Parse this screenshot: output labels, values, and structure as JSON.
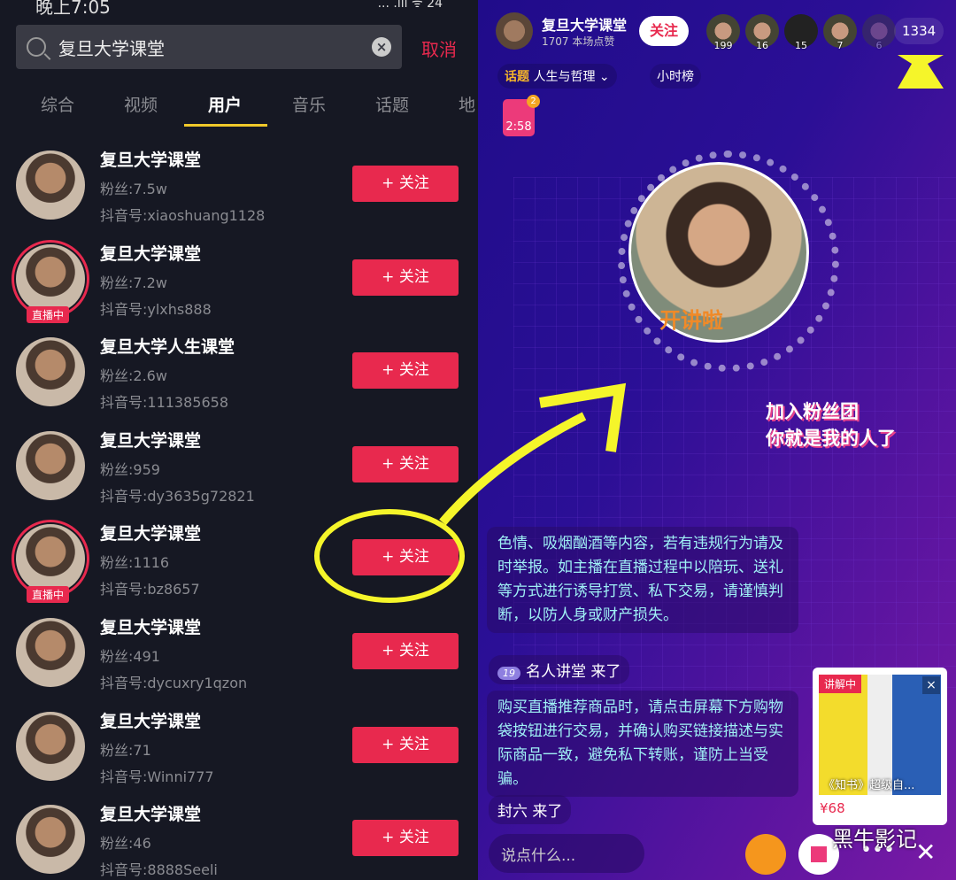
{
  "status": {
    "time": "晚上7:05",
    "icons": "... .ıll ᯤ 24"
  },
  "search": {
    "query": "复旦大学课堂",
    "cancel": "取消"
  },
  "tabs": [
    "综合",
    "视频",
    "用户",
    "音乐",
    "话题",
    "地"
  ],
  "users": [
    {
      "name": "复旦大学课堂",
      "fans": "粉丝:7.5w",
      "id": "抖音号:xiaoshuang1128",
      "live": false
    },
    {
      "name": "复旦大学课堂",
      "fans": "粉丝:7.2w",
      "id": "抖音号:ylxhs888",
      "live": true
    },
    {
      "name": "复旦大学人生课堂",
      "fans": "粉丝:2.6w",
      "id": "抖音号:111385658",
      "live": false
    },
    {
      "name": "复旦大学课堂",
      "fans": "粉丝:959",
      "id": "抖音号:dy3635g72821",
      "live": false
    },
    {
      "name": "复旦大学课堂",
      "fans": "粉丝:1116",
      "id": "抖音号:bz8657",
      "live": true
    },
    {
      "name": "复旦大学课堂",
      "fans": "粉丝:491",
      "id": "抖音号:dycuxry1qzon",
      "live": false
    },
    {
      "name": "复旦大学课堂",
      "fans": "粉丝:71",
      "id": "抖音号:Winni777",
      "live": false
    },
    {
      "name": "复旦大学课堂",
      "fans": "粉丝:46",
      "id": "抖音号:8888Seeli",
      "live": false
    }
  ],
  "follow_label": "+ 关注",
  "live_label": "直播中",
  "live": {
    "host": "复旦大学课堂",
    "likes": "1707 本场点赞",
    "follow": "关注",
    "viewers": [
      "199",
      "16",
      "15",
      "7",
      "6"
    ],
    "viewer_count": "1334",
    "topic_label": "话题",
    "topic": "人生与哲理 ⌄",
    "hourly": "小时榜",
    "redpacket_count": "2",
    "redpacket_time": "2:58",
    "disc_text": "开讲啦",
    "fanclub": [
      "加入粉丝团",
      "你就是我的人了"
    ],
    "notice1": "色情、吸烟酗酒等内容，若有违规行为请及时举报。如主播在直播过程中以陪玩、送礼等方式进行诱导打赏、私下交易，请谨慎判断，以防人身或财产损失。",
    "chat1_level": "19",
    "chat1": "名人讲堂 来了",
    "notice2": "购买直播推荐商品时，请点击屏幕下方购物袋按钮进行交易，并确认购买链接描述与实际商品一致，避免私下转账，谨防上当受骗。",
    "chat2": "封六 来了",
    "input_placeholder": "说点什么...",
    "product": {
      "tag": "讲解中",
      "name": "《知书》超级自...",
      "price": "¥68"
    },
    "watermark": "黑牛影记"
  },
  "colors": {
    "accent": "#e8294e",
    "tab_underline": "#f0c82a",
    "annotation": "#f5f52a"
  }
}
